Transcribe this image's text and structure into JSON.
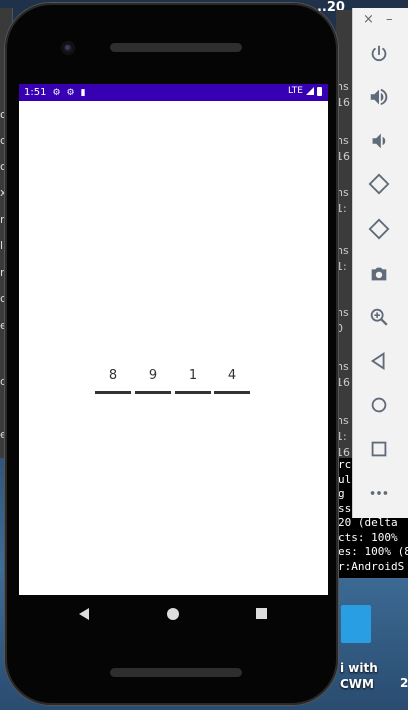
{
  "desktop": {
    "title_fragment": "...20",
    "left_chars": [
      "o",
      "c",
      "c",
      "x",
      "n",
      "l",
      "re",
      "c",
      "es",
      "d",
      "e"
    ],
    "right_fragments": [
      "ns",
      "16",
      "ns",
      "16",
      "ns",
      "1:",
      "ns",
      "1:",
      "ns",
      "0",
      "ns",
      "16",
      "ns",
      "1:",
      "16"
    ],
    "terminal_lines": [
      "rce",
      "ult",
      "g",
      "ss:",
      "20 (delta",
      "cts: 100%",
      "es: 100% (8",
      "r:AndroidS"
    ],
    "label_line1": "i with",
    "label_line2": "CWM",
    "label_extra": "2"
  },
  "toolbar": {
    "close_label": "×",
    "minimize_label": "–",
    "buttons": [
      "power-icon",
      "volume-up-icon",
      "volume-down-icon",
      "rotate-left-icon",
      "rotate-right-icon",
      "camera-icon",
      "zoom-icon",
      "back-icon",
      "home-icon",
      "overview-icon",
      "more-icon"
    ]
  },
  "status_bar": {
    "time": "1:51",
    "network": "LTE",
    "color": "#3700b3"
  },
  "pin": {
    "digits": [
      "8",
      "9",
      "1",
      "4"
    ]
  }
}
